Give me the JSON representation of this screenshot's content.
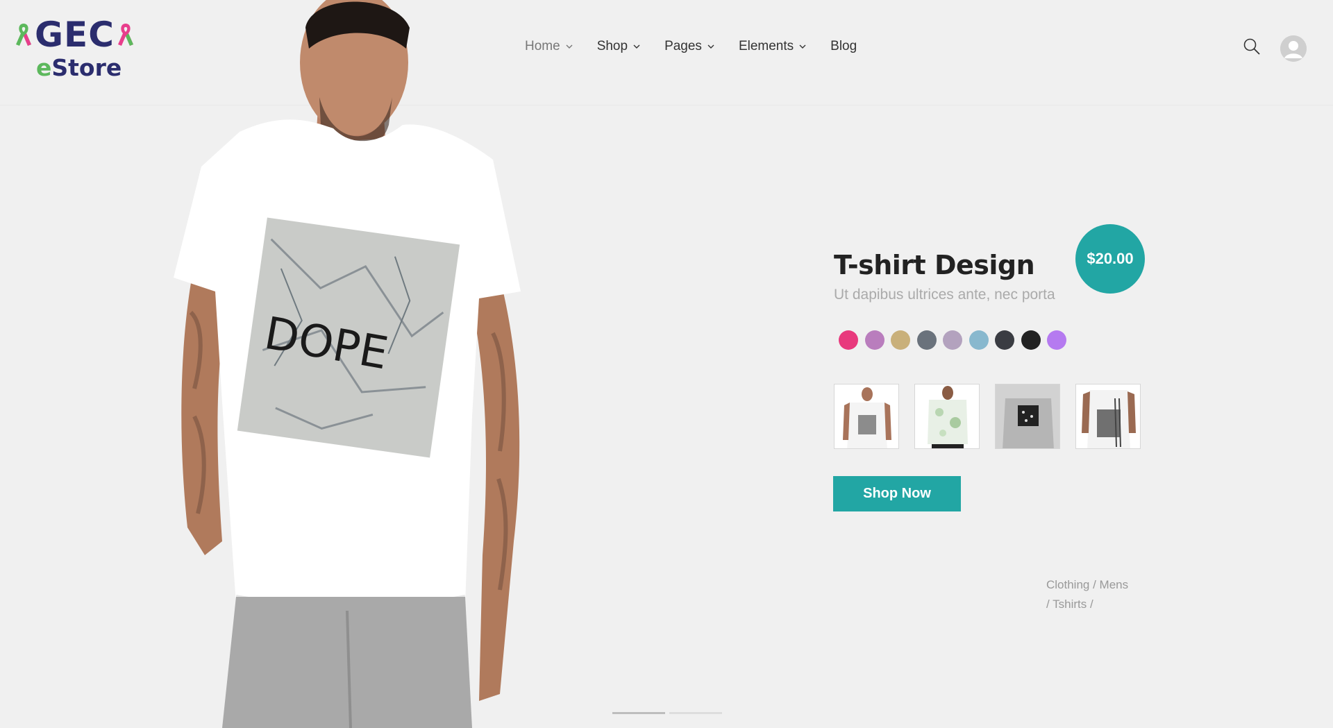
{
  "brand": {
    "name": "GEC",
    "sub_prefix": "e",
    "sub_rest": "Store",
    "colors": {
      "navy": "#2b2d6e",
      "green": "#5cb85c",
      "pink": "#e83e8c"
    }
  },
  "nav": {
    "items": [
      {
        "label": "Home",
        "dropdown": true,
        "active": true
      },
      {
        "label": "Shop",
        "dropdown": true
      },
      {
        "label": "Pages",
        "dropdown": true
      },
      {
        "label": "Elements",
        "dropdown": true
      },
      {
        "label": "Blog",
        "dropdown": false
      }
    ]
  },
  "header_icons": {
    "search": "search-icon",
    "account": "user-avatar-icon"
  },
  "hero": {
    "shirt_print": "DOPE"
  },
  "product": {
    "title": "T-shirt Design",
    "subtitle": "Ut dapibus ultrices ante, nec porta",
    "price": "$20.00",
    "accent_color": "#22a6a4",
    "colors": [
      "#e8397d",
      "#b97dbd",
      "#c9b07a",
      "#6a727c",
      "#b3a2be",
      "#88b8ce",
      "#3a3c42",
      "#222222",
      "#b57af0"
    ],
    "thumbnails": [
      {
        "name": "tee-ny-white"
      },
      {
        "name": "tee-floral-white"
      },
      {
        "name": "tee-gray-print"
      },
      {
        "name": "tee-striped-white"
      }
    ],
    "cta": "Shop Now",
    "breadcrumb_line1": "Clothing / Mens",
    "breadcrumb_line2": "/ Tshirts /"
  },
  "slider": {
    "count": 2,
    "active": 0
  }
}
